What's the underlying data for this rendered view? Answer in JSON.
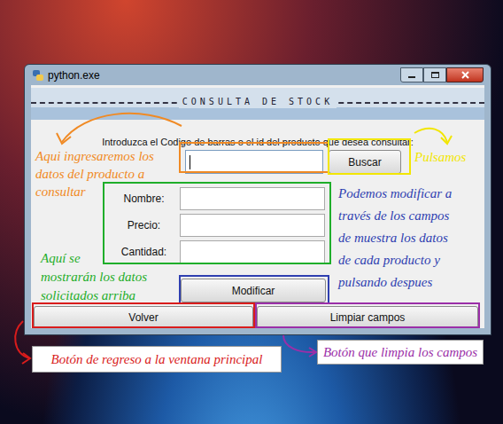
{
  "window": {
    "title": "python.exe"
  },
  "banner": "CONSULTA DE STOCK",
  "search": {
    "label": "Introduzca el Codigo de barras o el id del producto que desea consultar:",
    "value": "",
    "focused": true,
    "button": "Buscar"
  },
  "fields": [
    {
      "label": "Nombre:",
      "value": ""
    },
    {
      "label": "Precio:",
      "value": ""
    },
    {
      "label": "Cantidad:",
      "value": ""
    }
  ],
  "buttons": {
    "modify": "Modificar",
    "back": "Volver",
    "clear": "Limpiar campos"
  },
  "notes": {
    "input": {
      "lines": [
        "Aqui ingresaremos los",
        "datos del producto a",
        "consultar"
      ],
      "color": "#f08a24"
    },
    "search": {
      "lines": [
        "Pulsamos"
      ],
      "color": "#f2e600"
    },
    "modify": {
      "lines": [
        "Podemos modificar a",
        "través de los campos",
        "de muestra los datos",
        "de cada producto y",
        "pulsando despues"
      ],
      "color": "#2f3fb0"
    },
    "fields": {
      "lines": [
        "Aquí se",
        "mostrarán los datos",
        "solicitados arriba"
      ],
      "color": "#1fae2a"
    },
    "back": {
      "lines": [
        "Botón de regreso a la ventana principal"
      ],
      "color": "#d91c1c"
    },
    "clear": {
      "lines": [
        "Botón que limpia los campos"
      ],
      "color": "#9b2fa8"
    }
  }
}
